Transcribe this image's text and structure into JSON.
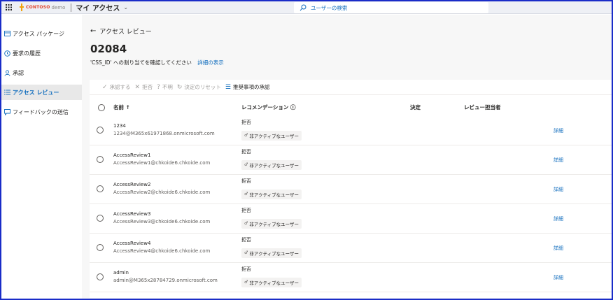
{
  "topbar": {
    "brand_name": "CONTOSO",
    "brand_suffix": "demo",
    "app_title": "マイ アクセス",
    "search_placeholder": "ユーザーの検索"
  },
  "sidebar": {
    "items": [
      {
        "label": "アクセス パッケージ",
        "icon": "package-icon"
      },
      {
        "label": "要求の履歴",
        "icon": "history-icon"
      },
      {
        "label": "承認",
        "icon": "person-icon"
      },
      {
        "label": "アクセス レビュー",
        "icon": "list-icon",
        "active": true
      },
      {
        "label": "フィードバックの送信",
        "icon": "feedback-icon"
      }
    ]
  },
  "page": {
    "back_label": "アクセス レビュー",
    "title": "02084",
    "subtitle": "'CSS_ID' への割り当てを確認してください",
    "details_link": "詳細の表示"
  },
  "toolbar": {
    "approve": "承認する",
    "deny": "拒否",
    "dont_know": "不明",
    "reset": "決定のリセット",
    "accept_recommendations": "推奨事項の承認"
  },
  "table": {
    "headers": {
      "name": "名前 ↑",
      "recommendation": "レコメンデーション ⓘ",
      "decision": "決定",
      "reviewer": "レビュー担当者"
    },
    "rows": [
      {
        "name": "1234",
        "email": "1234@M365x61971868.onmicrosoft.com",
        "recommendation": "拒否",
        "chip": "非アクティブなユーザー",
        "action": "詳細"
      },
      {
        "name": "AccessReview1",
        "email": "AccessReview1@chkoide6.chkoide.com",
        "recommendation": "拒否",
        "chip": "非アクティブなユーザー",
        "action": "詳細"
      },
      {
        "name": "AccessReview2",
        "email": "AccessReview2@chkoide6.chkoide.com",
        "recommendation": "拒否",
        "chip": "非アクティブなユーザー",
        "action": "詳細"
      },
      {
        "name": "AccessReview3",
        "email": "AccessReview3@chkoide6.chkoide.com",
        "recommendation": "拒否",
        "chip": "非アクティブなユーザー",
        "action": "詳細"
      },
      {
        "name": "AccessReview4",
        "email": "AccessReview4@chkoide6.chkoide.com",
        "recommendation": "拒否",
        "chip": "非アクティブなユーザー",
        "action": "詳細"
      },
      {
        "name": "admin",
        "email": "admin@M365x28784729.onmicrosoft.com",
        "recommendation": "拒否",
        "chip": "非アクティブなユーザー",
        "action": "詳細"
      }
    ]
  },
  "colors": {
    "accent": "#0f6cbd",
    "frame": "#1a2cc8",
    "brand": "#e0432c"
  }
}
